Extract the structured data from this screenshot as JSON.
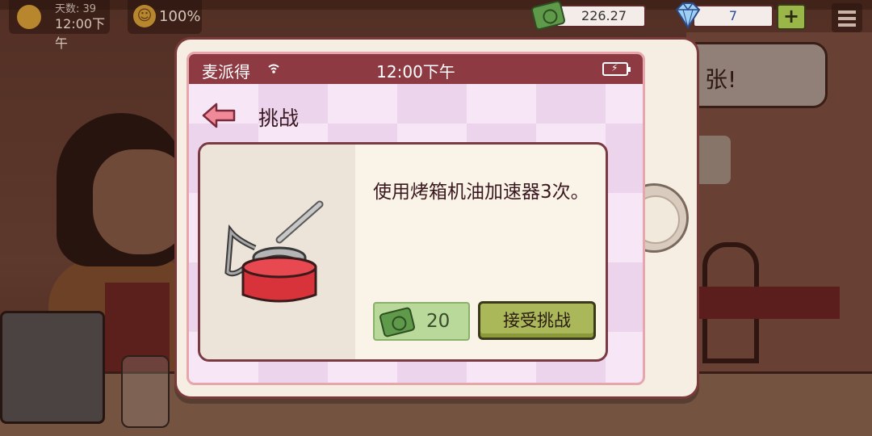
{
  "hud": {
    "day_label": "天数: 39",
    "time": "12:00下午",
    "mood_percent": "100%",
    "cash": "226.27",
    "gems": "7",
    "add_gems_label": "+"
  },
  "background": {
    "speech_text": "张!"
  },
  "phone": {
    "carrier": "麦派得",
    "clock": "12:00下午",
    "page_title": "挑战"
  },
  "challenge": {
    "description": "使用烤箱机油加速器3次。",
    "reward_amount": "20",
    "accept_label": "接受挑战",
    "item_icon": "oil-can-icon"
  },
  "colors": {
    "status_bar": "#8d3a42",
    "accept_button": "#aab85a",
    "reward_bg": "#b8d99a",
    "cash_green": "#5f9a4a"
  }
}
